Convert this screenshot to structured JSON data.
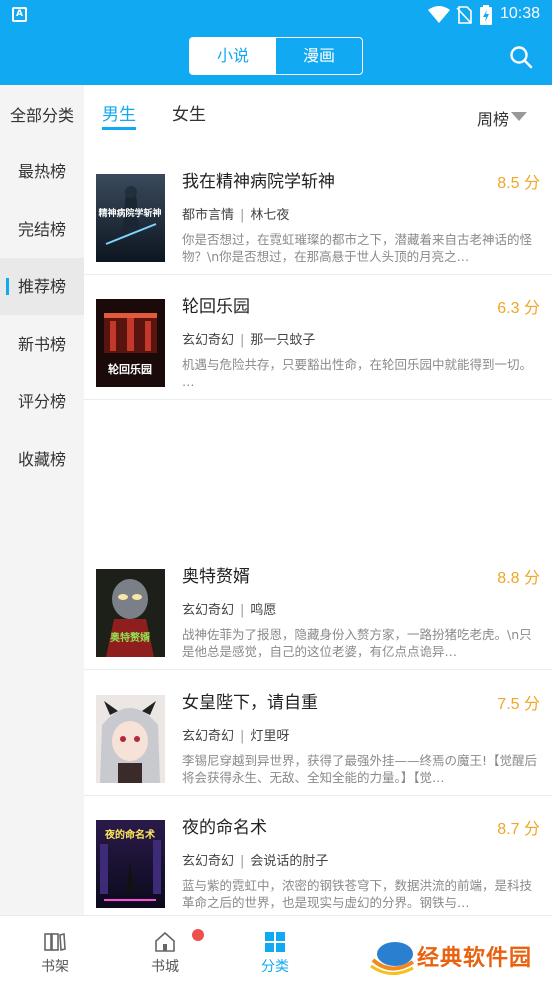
{
  "status_bar": {
    "time": "10:38",
    "app_icon_letter": "A"
  },
  "header": {
    "segments": [
      {
        "label": "小说",
        "active": true
      },
      {
        "label": "漫画",
        "active": false
      }
    ],
    "search_icon": "search-icon",
    "accent": "#12a9f3"
  },
  "sidebar": {
    "items": [
      {
        "label": "全部分类",
        "active": false
      },
      {
        "label": "最热榜",
        "active": false
      },
      {
        "label": "完结榜",
        "active": false
      },
      {
        "label": "推荐榜",
        "active": true
      },
      {
        "label": "新书榜",
        "active": false
      },
      {
        "label": "评分榜",
        "active": false
      },
      {
        "label": "收藏榜",
        "active": false
      }
    ]
  },
  "filters": {
    "gender_tabs": [
      {
        "label": "男生",
        "active": true
      },
      {
        "label": "女生",
        "active": false
      }
    ],
    "ranking": "周榜"
  },
  "books": [
    {
      "title": "我在精神病院学斩神",
      "score": "8.5 分",
      "genre": "都市言情",
      "author": "林七夜",
      "desc": "你是否想过，在霓虹璀璨的都市之下，潜藏着来自古老神话的怪物？\\n你是否想过，在那高悬于世人头顶的月亮之…"
    },
    {
      "title": "轮回乐园",
      "score": "6.3 分",
      "genre": "玄幻奇幻",
      "author": "那一只蚊子",
      "desc": "机遇与危险共存，只要豁出性命，在轮回乐园中就能得到一切。 …"
    },
    {
      "title": "奥特赘婿",
      "score": "8.8 分",
      "genre": "玄幻奇幻",
      "author": "鸣愿",
      "desc": "战神佐菲为了报恩，隐藏身份入赘方家，一路扮猪吃老虎。\\n只是他总是感觉，自己的这位老婆，有亿点点诡异…"
    },
    {
      "title": "女皇陛下，请自重",
      "score": "7.5 分",
      "genre": "玄幻奇幻",
      "author": "灯里呀",
      "desc": "李锡尼穿越到异世界，获得了最强外挂——终焉の魔王!【觉醒后将会获得永生、无敌、全知全能的力量。】【觉…"
    },
    {
      "title": "夜的命名术",
      "score": "8.7 分",
      "genre": "玄幻奇幻",
      "author": "会说话的肘子",
      "desc": "蓝与紫的霓虹中，浓密的钢铁苍穹下，数据洪流的前端，是科技革命之后的世界，也是现实与虚幻的分界。钢铁与…"
    }
  ],
  "covers": {
    "book1_text": "精神病院学斩神",
    "book2_text": "轮回乐园",
    "book3_text": "奥特赘婿",
    "book5_text": "夜的命名术"
  },
  "bottom_nav": {
    "items": [
      {
        "label": "书架",
        "icon": "bookshelf-icon",
        "active": false
      },
      {
        "label": "书城",
        "icon": "home-icon",
        "active": false
      },
      {
        "label": "分类",
        "icon": "category-grid-icon",
        "active": true
      }
    ]
  },
  "watermark": {
    "text": "经典软件园"
  }
}
